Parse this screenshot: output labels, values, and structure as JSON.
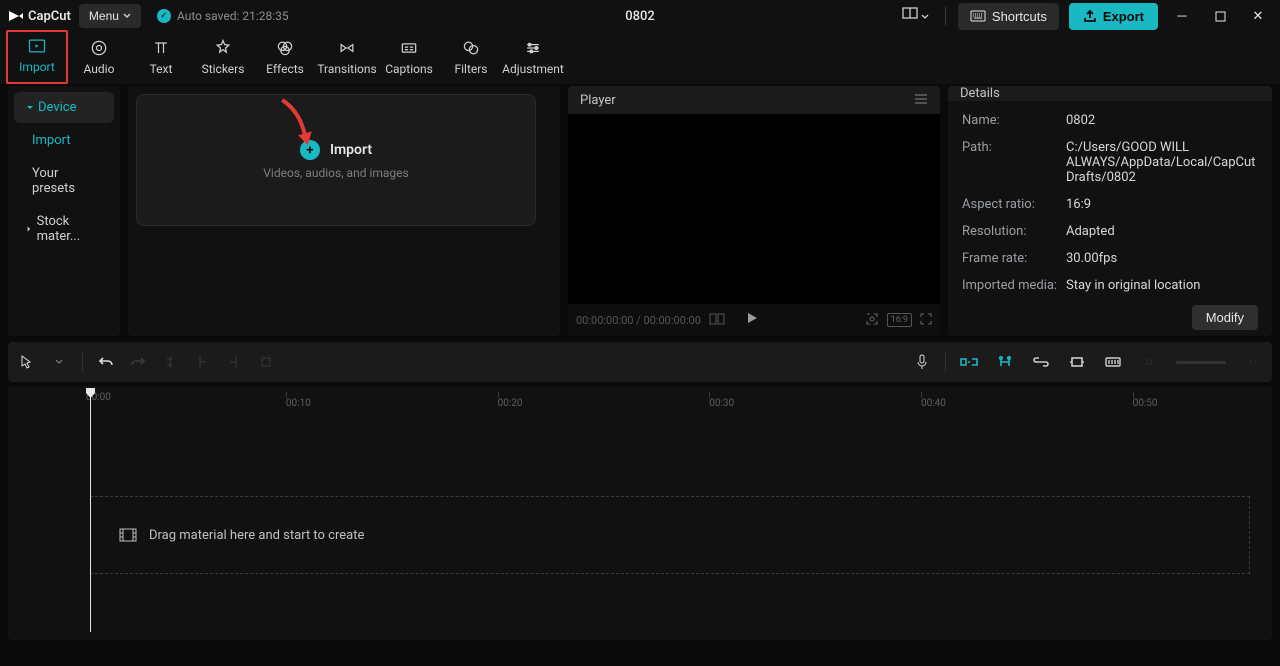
{
  "titlebar": {
    "app_name": "CapCut",
    "menu_label": "Menu",
    "autosave_label": "Auto saved: 21:28:35",
    "project_title": "0802",
    "shortcuts_label": "Shortcuts",
    "export_label": "Export"
  },
  "editor_tabs": [
    {
      "id": "import",
      "label": "Import",
      "active": true
    },
    {
      "id": "audio",
      "label": "Audio"
    },
    {
      "id": "text",
      "label": "Text"
    },
    {
      "id": "stickers",
      "label": "Stickers"
    },
    {
      "id": "effects",
      "label": "Effects"
    },
    {
      "id": "transitions",
      "label": "Transitions"
    },
    {
      "id": "captions",
      "label": "Captions"
    },
    {
      "id": "filters",
      "label": "Filters"
    },
    {
      "id": "adjustment",
      "label": "Adjustment"
    }
  ],
  "sidebar": {
    "device_label": "Device",
    "import_label": "Import",
    "presets_label": "Your presets",
    "stock_label": "Stock mater..."
  },
  "media_drop": {
    "title": "Import",
    "subtitle": "Videos, audios, and images"
  },
  "player": {
    "header": "Player",
    "time": "00:00:00:00 / 00:00:00:00",
    "ratio_badge": "16:9"
  },
  "details": {
    "header": "Details",
    "labels": {
      "name": "Name:",
      "path": "Path:",
      "aspect": "Aspect ratio:",
      "resolution": "Resolution:",
      "framerate": "Frame rate:",
      "imported": "Imported media:"
    },
    "values": {
      "name": "0802",
      "path": "C:/Users/GOOD WILL ALWAYS/AppData/Local/CapCut Drafts/0802",
      "aspect": "16:9",
      "resolution": "Adapted",
      "framerate": "30.00fps",
      "imported": "Stay in original location"
    },
    "modify_label": "Modify"
  },
  "timeline": {
    "ticks": [
      "00:00",
      "00:10",
      "00:20",
      "00:30",
      "00:40",
      "00:50"
    ],
    "hint": "Drag material here and start to create"
  }
}
